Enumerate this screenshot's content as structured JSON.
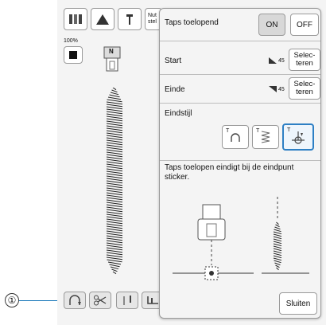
{
  "toolbar": {
    "cut_label": "Nut\nstel"
  },
  "zoom": "100%",
  "foot_letter": "N",
  "callout": "①",
  "panel": {
    "taper_title": "Taps toelopend",
    "on_label": "ON",
    "off_label": "OFF",
    "start_label": "Start",
    "start_angle": "45",
    "end_label": "Einde",
    "end_angle": "45",
    "select_label": "Selec-\nteren",
    "end_style_label": "Eindstijl",
    "end_style_t": "T",
    "description": "Taps toelopen eindigt bij de eindpunt sticker.",
    "close_label": "Sluiten"
  }
}
